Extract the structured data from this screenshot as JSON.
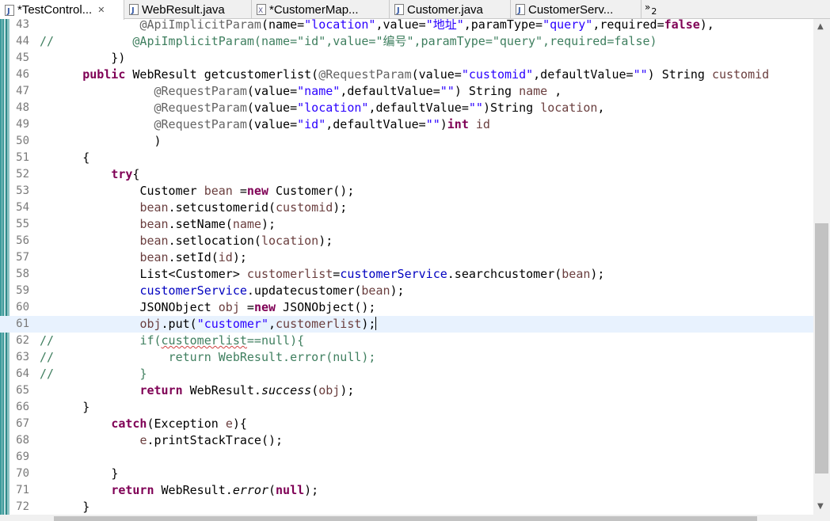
{
  "tabs": [
    {
      "label": "*TestControl...",
      "close": "✕",
      "icon": "java-file-icon"
    },
    {
      "label": "WebResult.java",
      "icon": "java-file-icon"
    },
    {
      "label": "*CustomerMap...",
      "icon": "xml-file-icon"
    },
    {
      "label": "Customer.java",
      "icon": "java-file-icon"
    },
    {
      "label": "CustomerServ...",
      "icon": "java-file-icon"
    }
  ],
  "overflow": {
    "chevron": "»",
    "count": "2"
  },
  "line_numbers": [
    "43",
    "44",
    "45",
    "46",
    "47",
    "48",
    "49",
    "50",
    "51",
    "52",
    "53",
    "54",
    "55",
    "56",
    "57",
    "58",
    "59",
    "60",
    "61",
    "62",
    "63",
    "64",
    "65",
    "66",
    "67",
    "68",
    "69",
    "70",
    "71",
    "72"
  ],
  "code": {
    "l43": [
      "@ApiImplicitParam",
      "(name=",
      "\"location\"",
      ",value=",
      "\"地址\"",
      ",paramType=",
      "\"query\"",
      ",required=",
      "false",
      "),"
    ],
    "l44": "//           @ApiImplicitParam(name=\"id\",value=\"编号\",paramType=\"query\",required=false)",
    "l45": "          })",
    "l46": [
      "public",
      " WebResult getcustomerlist(",
      "@RequestParam",
      "(value=",
      "\"customid\"",
      ",defaultValue=",
      "\"\"",
      ") String ",
      "customid"
    ],
    "l47": [
      "@RequestParam",
      "(value=",
      "\"name\"",
      ",defaultValue=",
      "\"\"",
      ") String ",
      "name",
      " ,"
    ],
    "l48": [
      "@RequestParam",
      "(value=",
      "\"location\"",
      ",defaultValue=",
      "\"\"",
      ")String ",
      "location",
      ","
    ],
    "l49": [
      "@RequestParam",
      "(value=",
      "\"id\"",
      ",defaultValue=",
      "\"\"",
      ")",
      "int",
      " ",
      "id"
    ],
    "l50": ")",
    "l51": "{",
    "l52": [
      "try",
      "{"
    ],
    "l53": [
      "Customer ",
      "bean",
      " =",
      "new",
      " Customer();"
    ],
    "l54": [
      "bean",
      ".setcustomerid(",
      "customid",
      ");"
    ],
    "l55": [
      "bean",
      ".setName(",
      "name",
      ");"
    ],
    "l56": [
      "bean",
      ".setlocation(",
      "location",
      ");"
    ],
    "l57": [
      "bean",
      ".setId(",
      "id",
      ");"
    ],
    "l58": [
      "List<Customer> ",
      "customerlist",
      "=",
      "customerService",
      ".searchcustomer(",
      "bean",
      ");"
    ],
    "l59": [
      "customerService",
      ".updatecustomer(",
      "bean",
      ");"
    ],
    "l60": [
      "JSONObject ",
      "obj",
      " =",
      "new",
      " JSONObject();"
    ],
    "l61": [
      "obj",
      ".put(",
      "\"customer\"",
      ",",
      "customerlist",
      ");"
    ],
    "l62": [
      "//",
      "if(",
      "customerlist",
      "==null){"
    ],
    "l63": [
      "//",
      "return WebResult.error(null);"
    ],
    "l64": [
      "//",
      "}"
    ],
    "l65": [
      "return",
      " WebResult.",
      "success",
      "(",
      "obj",
      ");"
    ],
    "l66": "}",
    "l67": [
      "catch",
      "(Exception ",
      "e",
      "){"
    ],
    "l68": [
      "e",
      ".printStackTrace();"
    ],
    "l69": "",
    "l70": "}",
    "l71": [
      "return",
      " WebResult.",
      "error",
      "(",
      "null",
      ");"
    ],
    "l72": "}"
  },
  "colors": {
    "keyword": "#7f0055",
    "string": "#2a00ff",
    "annotation": "#646464",
    "local_var": "#6a3e3e",
    "field": "#0000c0",
    "comment": "#3f7f5f",
    "current_line": "#e8f2fe"
  }
}
